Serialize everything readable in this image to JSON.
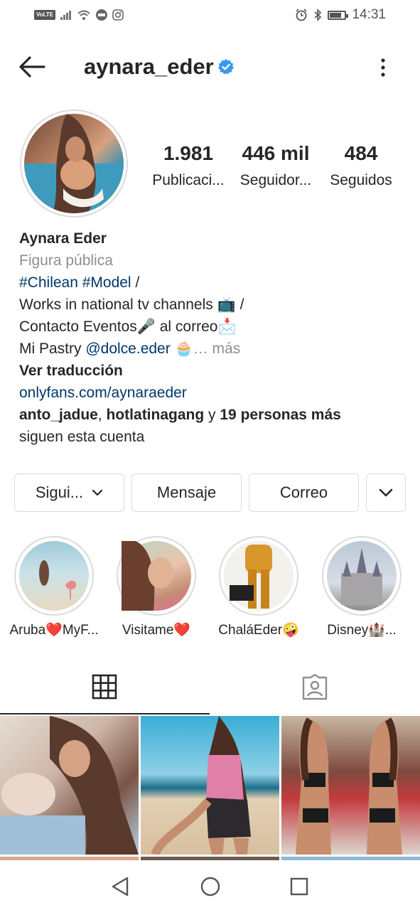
{
  "status_bar": {
    "carrier_badge": "VoLTE",
    "time": "14:31",
    "battery_level_percent": 70
  },
  "header": {
    "username": "aynara_eder",
    "verified": true
  },
  "stats": [
    {
      "value": "1.981",
      "label": "Publicaci..."
    },
    {
      "value": "446 mil",
      "label": "Seguidor..."
    },
    {
      "value": "484",
      "label": "Seguidos"
    }
  ],
  "bio": {
    "name": "Aynara Eder",
    "category": "Figura pública",
    "hashtags": "#Chilean #Model",
    "hashtags_suffix": " /",
    "line2": "Works in national tv channels 📺 /",
    "line3": "Contacto Eventos🎤 al correo📩",
    "line4_prefix": "Mi Pastry ",
    "line4_mention": "@dolce.eder",
    "line4_emoji": " 🧁",
    "more": "… más",
    "translate": "Ver traducción",
    "link": "onlyfans.com/aynaraeder",
    "followed_by_1": "anto_jadue",
    "followed_by_sep": ", ",
    "followed_by_2": "hotlatinagang",
    "followed_by_y": " y ",
    "followed_by_more": "19 personas más",
    "followed_suffix": "siguen esta cuenta"
  },
  "buttons": {
    "following": "Sigui...",
    "message": "Mensaje",
    "email": "Correo"
  },
  "highlights": [
    {
      "caption": "Aruba❤️MyF..."
    },
    {
      "caption": "Visitame❤️"
    },
    {
      "caption": "ChaláEder🤪"
    },
    {
      "caption": "Disney🏰..."
    }
  ],
  "colors": {
    "verified_blue": "#3897f0",
    "link_navy": "#00376b",
    "muted_gray": "#8e8e8e",
    "border_gray": "#dbdbdb"
  },
  "icons": {
    "back": "arrow-left-icon",
    "more": "kebab-icon",
    "grid_tab": "grid-icon",
    "tagged_tab": "tagged-person-icon",
    "nav": [
      "back-triangle-icon",
      "home-circle-icon",
      "recents-square-icon"
    ]
  }
}
